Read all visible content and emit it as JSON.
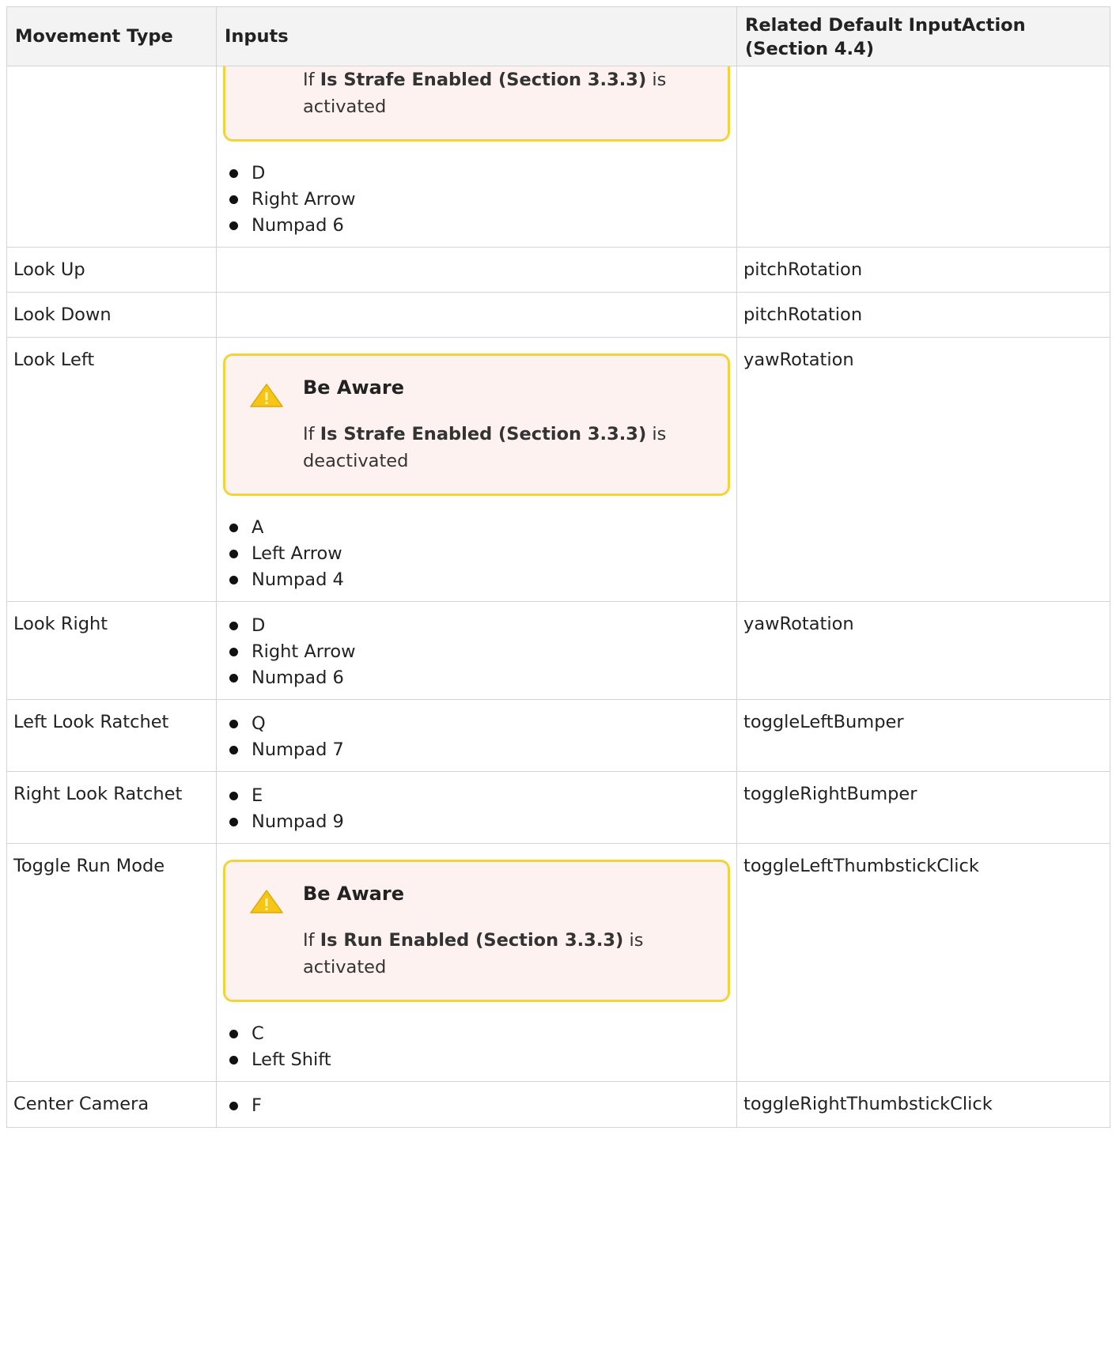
{
  "headers": {
    "movement_type": "Movement Type",
    "inputs": "Inputs",
    "related_action": "Related Default InputAction (Section 4.4)"
  },
  "rows": [
    {
      "movement": "",
      "aware": {
        "title": "",
        "prefix": "If ",
        "setting": "Is Strafe Enabled (Section 3.3.3)",
        "suffix": " is activated"
      },
      "keys": [
        "D",
        "Right Arrow",
        "Numpad 6"
      ],
      "action": ""
    },
    {
      "movement": "Look Up",
      "keys": [],
      "action": "pitchRotation"
    },
    {
      "movement": "Look Down",
      "keys": [],
      "action": "pitchRotation"
    },
    {
      "movement": "Look Left",
      "aware": {
        "title": "Be Aware",
        "prefix": "If ",
        "setting": "Is Strafe Enabled (Section 3.3.3)",
        "suffix": " is deactivated"
      },
      "keys": [
        "A",
        "Left Arrow",
        "Numpad 4"
      ],
      "action": "yawRotation"
    },
    {
      "movement": "Look Right",
      "keys": [
        "D",
        "Right Arrow",
        "Numpad 6"
      ],
      "action": "yawRotation"
    },
    {
      "movement": "Left Look Ratchet",
      "keys": [
        "Q",
        "Numpad 7"
      ],
      "action": "toggleLeftBumper"
    },
    {
      "movement": "Right Look Ratchet",
      "keys": [
        "E",
        "Numpad 9"
      ],
      "action": "toggleRightBumper"
    },
    {
      "movement": "Toggle Run Mode",
      "aware": {
        "title": "Be Aware",
        "prefix": "If ",
        "setting": "Is Run Enabled (Section 3.3.3)",
        "suffix": " is activated"
      },
      "keys": [
        "C",
        "Left Shift"
      ],
      "action": "toggleLeftThumbstickClick"
    },
    {
      "movement": "Center Camera",
      "keys": [
        "F"
      ],
      "action": "toggleRightThumbstickClick"
    }
  ],
  "colors": {
    "header_bg": "#f3f3f3",
    "border": "#d4d4d4",
    "aware_border": "#f2d43a",
    "aware_bg": "#fdf2f0",
    "warning_icon": "#f5c518"
  },
  "icons": {
    "aware_icon": "warning-triangle-icon"
  }
}
